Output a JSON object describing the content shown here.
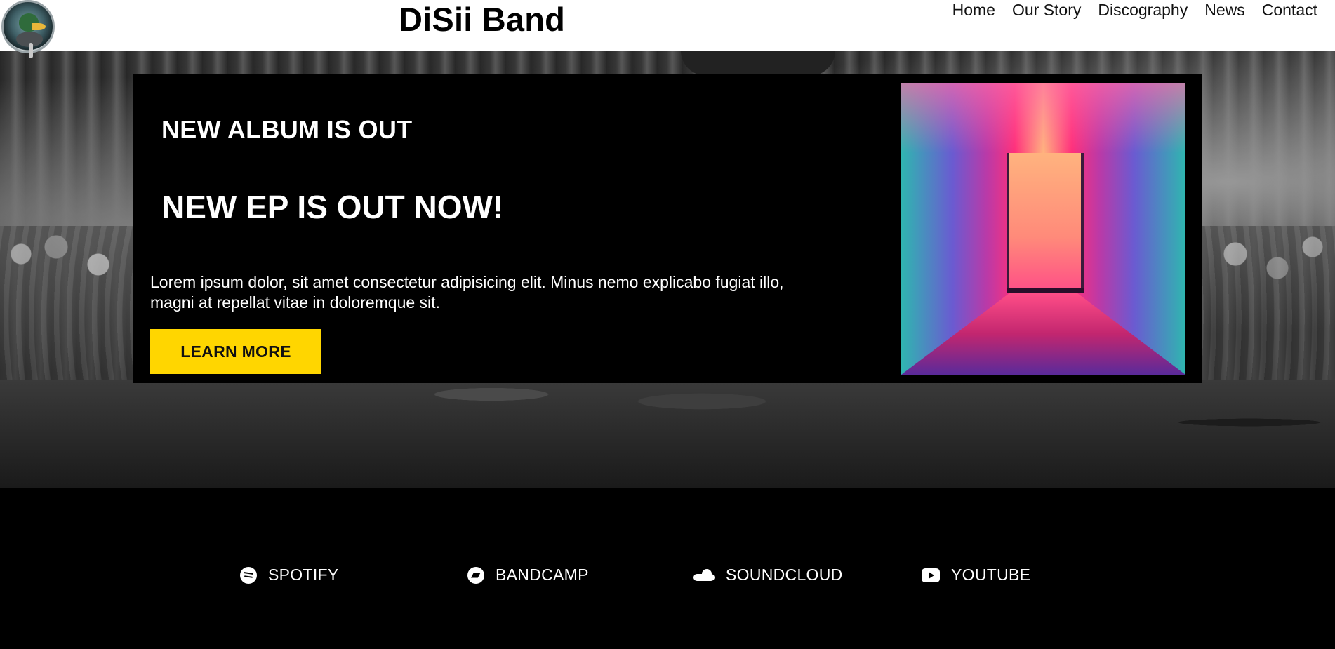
{
  "header": {
    "site_title": "DiSii Band",
    "logo_icon": "duck-with-microphone-logo",
    "nav": [
      {
        "label": "Home"
      },
      {
        "label": "Our Story"
      },
      {
        "label": "Discography"
      },
      {
        "label": "News"
      },
      {
        "label": "Contact"
      }
    ]
  },
  "hero": {
    "kicker": "NEW ALBUM IS OUT",
    "title": "NEW EP IS OUT NOW!",
    "body": "Lorem ipsum dolor, sit amet consectetur adipisicing elit. Minus nemo explicabo fugiat illo, magni at repellat vitae in doloremque sit.",
    "button_label": "LEARN MORE",
    "button_color": "#ffd600",
    "image_icon": "neon-corridor-image"
  },
  "social_links": [
    {
      "label": "SPOTIFY",
      "icon": "spotify-icon"
    },
    {
      "label": "BANDCAMP",
      "icon": "bandcamp-icon"
    },
    {
      "label": "SOUNDCLOUD",
      "icon": "soundcloud-icon"
    },
    {
      "label": "YOUTUBE",
      "icon": "youtube-icon"
    }
  ]
}
